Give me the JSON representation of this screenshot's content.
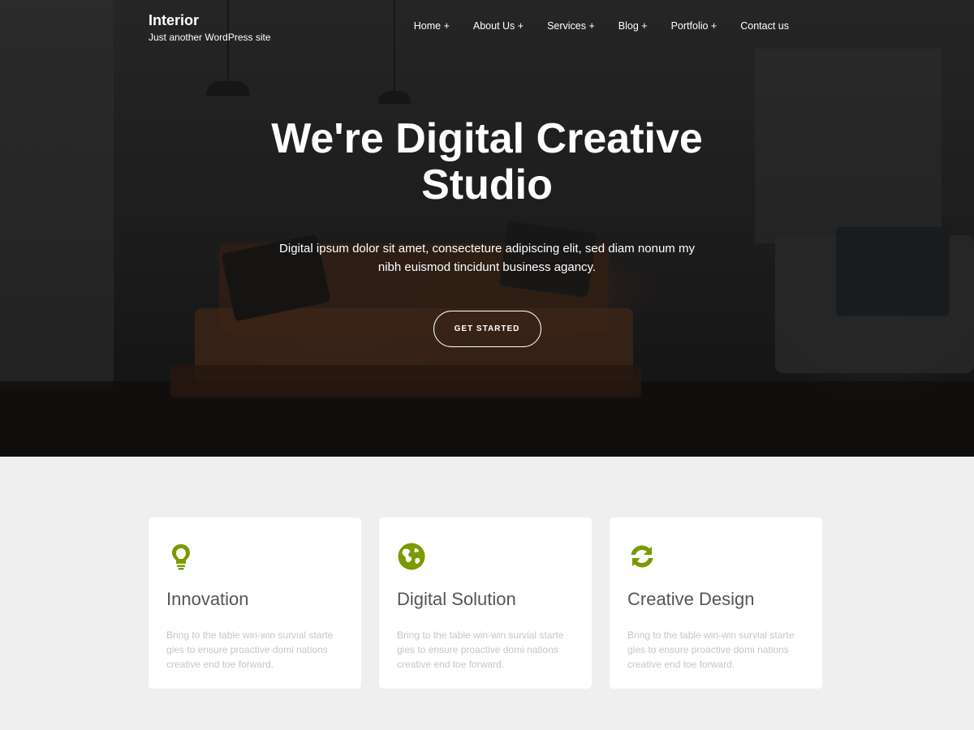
{
  "site": {
    "title": "Interior",
    "tagline": "Just another WordPress site"
  },
  "nav": {
    "items": [
      {
        "label": "Home +"
      },
      {
        "label": "About Us +"
      },
      {
        "label": "Services +"
      },
      {
        "label": "Blog +"
      },
      {
        "label": "Portfolio +"
      },
      {
        "label": "Contact us"
      }
    ]
  },
  "hero": {
    "title": "We're Digital Creative Studio",
    "text": "Digital ipsum dolor sit amet, consecteture adipiscing elit, sed diam nonum my nibh euismod tincidunt business agancy.",
    "button_label": "GET STARTED"
  },
  "features": [
    {
      "icon": "lightbulb-icon",
      "title": "Innovation",
      "text": "Bring to the table win-win survial starte gies to ensure proactive domi nations creative end toe forward."
    },
    {
      "icon": "globe-icon",
      "title": "Digital Solution",
      "text": "Bring to the table win-win survial starte gies to ensure proactive domi nations creative end toe forward."
    },
    {
      "icon": "refresh-icon",
      "title": "Creative Design",
      "text": "Bring to the table win-win survial starte gies to ensure proactive domi nations creative end toe forward."
    }
  ],
  "colors": {
    "accent": "#7a9a01",
    "card_title": "#555555",
    "card_text": "#c6c6c6",
    "section_bg": "#efefef"
  }
}
